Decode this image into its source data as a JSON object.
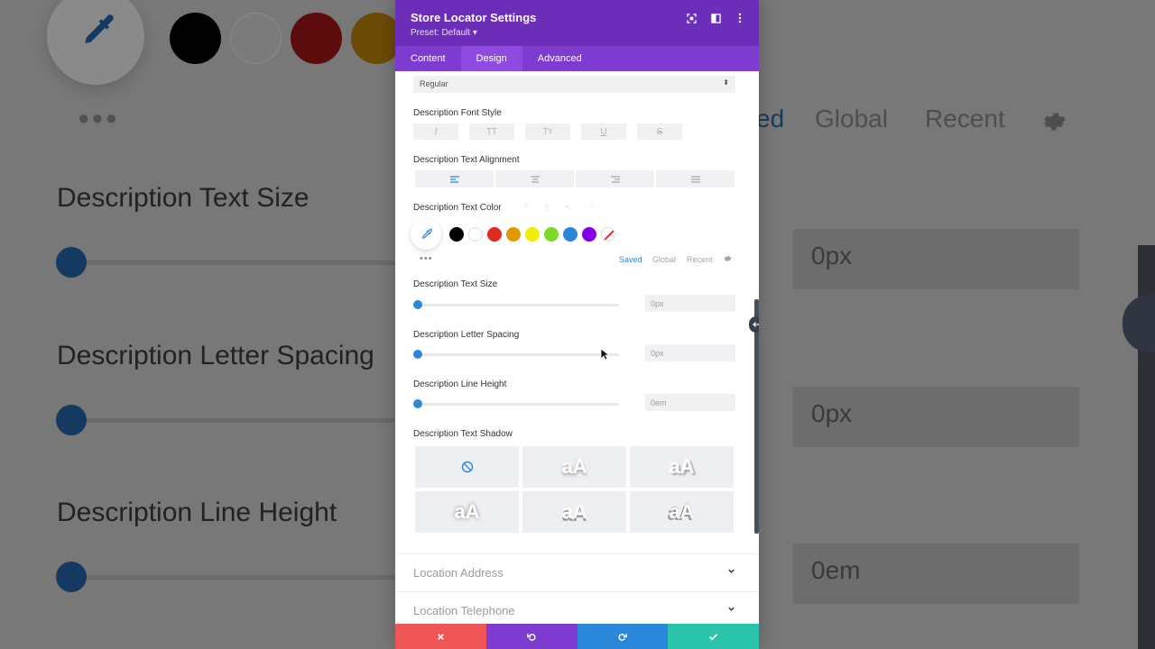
{
  "background": {
    "titles": [
      "Description Text Size",
      "Description Letter Spacing",
      "Description Line Height"
    ],
    "tabs": [
      "ed",
      "Global",
      "Recent"
    ],
    "values": [
      "0px",
      "0px",
      "0em"
    ],
    "swatch_colors": [
      "#000000",
      "#7b7b7b",
      "#5c0c0c",
      "#6b4a05"
    ]
  },
  "modal": {
    "title": "Store Locator Settings",
    "preset": "Preset: Default ▾",
    "tabs": {
      "content": "Content",
      "design": "Design",
      "advanced": "Advanced"
    },
    "font_weight_select": "Regular",
    "font_style": {
      "label": "Description Font Style",
      "buttons": [
        "I",
        "TT",
        "Tт",
        "U",
        "S"
      ]
    },
    "alignment": {
      "label": "Description Text Alignment"
    },
    "text_color": {
      "label": "Description Text Color",
      "swatches": [
        "#000000",
        "#ffffff",
        "#e02b20",
        "#e09900",
        "#edf000",
        "#7cda24",
        "#2b87da",
        "#8300e9"
      ],
      "more": "•••",
      "palette_tabs": {
        "saved": "Saved",
        "global": "Global",
        "recent": "Recent"
      }
    },
    "text_size": {
      "label": "Description Text Size",
      "value": "0px"
    },
    "letter_spacing": {
      "label": "Description Letter Spacing",
      "value": "0px"
    },
    "line_height": {
      "label": "Description Line Height",
      "value": "0em"
    },
    "text_shadow": {
      "label": "Description Text Shadow",
      "preview": "aA"
    },
    "accordions": {
      "address": "Location Address",
      "telephone": "Location Telephone"
    }
  },
  "colors": {
    "header": "#6c2eb9",
    "tabs": "#7e3bd0",
    "accent": "#2b87da",
    "cancel": "#ef5555",
    "undo": "#7e3bd0",
    "redo": "#2b87da",
    "save": "#29c4a9"
  }
}
